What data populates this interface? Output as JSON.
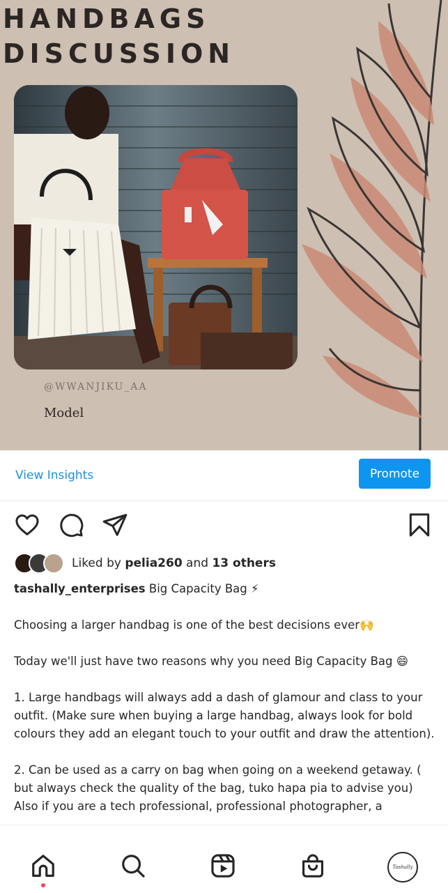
{
  "post_image": {
    "title_line1": "HANDBAGS",
    "title_line2": "DISCUSSION",
    "credit": "@WWANJIKU_AA",
    "role": "Model"
  },
  "insights": {
    "view_label": "View Insights",
    "promote_label": "Promote"
  },
  "actions": {
    "like_icon": "heart-icon",
    "comment_icon": "comment-icon",
    "share_icon": "send-icon",
    "save_icon": "bookmark-icon"
  },
  "likes": {
    "prefix": "Liked by ",
    "user": "pelia260",
    "middle": " and ",
    "others": "13 others"
  },
  "caption": {
    "username": "tashally_enterprises",
    "headline": " Big Capacity Bag ⚡",
    "p1": "Choosing a larger handbag is one of the best decisions ever🙌",
    "p2": "Today we'll  just have two reasons why you need Big Capacity Bag 😄",
    "p3": " 1. Large handbags will always add a dash of glamour and class to your outfit. (Make sure when buying a large handbag, always look for bold colours  they add an elegant touch to your outfit and draw the attention).",
    "p4": "2. Can be used as a carry on bag when going on a weekend getaway. ( but always check the quality of the bag, tuko hapa pia to advise you)",
    "p5": "Also if  you are a tech professional,  professional photographer, a"
  },
  "nav": {
    "home_icon": "home-icon",
    "search_icon": "search-icon",
    "reels_icon": "reels-icon",
    "shop_icon": "shop-icon",
    "profile_label": "Tashally"
  },
  "colors": {
    "accent": "#0e95f0",
    "link": "#1f8fe0",
    "poster_bg": "#cdbfb2",
    "leaf": "#c98a74"
  }
}
